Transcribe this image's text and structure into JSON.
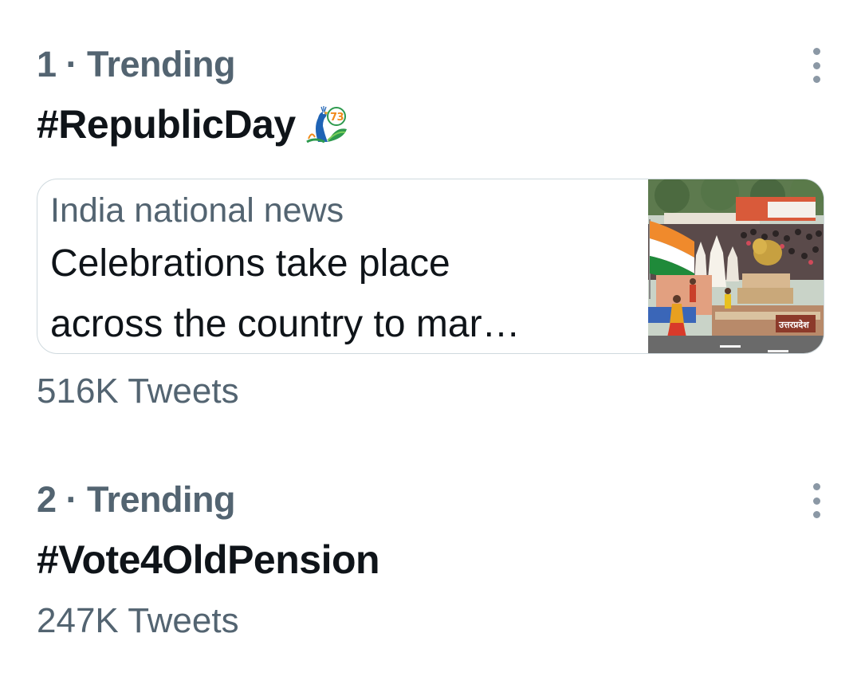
{
  "trends": [
    {
      "meta": "1 · Trending",
      "hashtag": "#RepublicDay",
      "hashflag_icon": "peacock-73-emoji-icon",
      "news": {
        "source": "India national news",
        "headline_line1": "Celebrations take place",
        "headline_line2": "across the country to mar…",
        "thumb_caption": "उत्तरप्रदेश"
      },
      "tweet_count": "516K Tweets"
    },
    {
      "meta": "2 · Trending",
      "hashtag": "#Vote4OldPension",
      "tweet_count": "247K Tweets"
    }
  ],
  "colors": {
    "primary_text": "#0f1419",
    "secondary_text": "#536471",
    "border": "#cfd9de"
  }
}
